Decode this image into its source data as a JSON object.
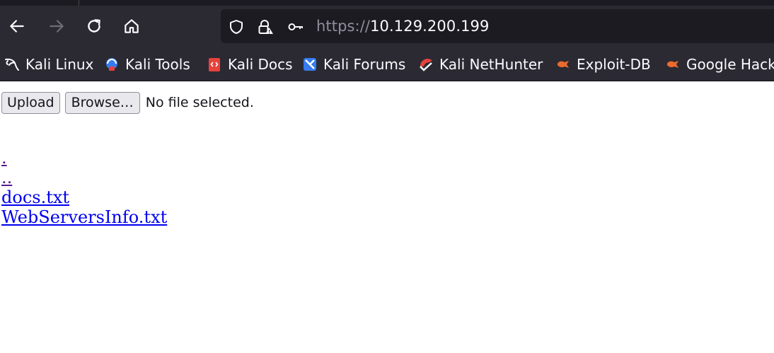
{
  "browser": {
    "url": {
      "scheme": "https://",
      "host": "10.129.200.199"
    },
    "nav_icons": [
      "back-icon",
      "forward-icon",
      "reload-icon",
      "home-icon"
    ],
    "url_icons": [
      "shield-icon",
      "lock-warning-icon",
      "key-icon"
    ],
    "bookmarks": [
      {
        "label": "Kali Linux",
        "icon": "kali-dragon-icon"
      },
      {
        "label": "Kali Tools",
        "icon": "kali-tools-icon"
      },
      {
        "label": "Kali Docs",
        "icon": "kali-docs-icon"
      },
      {
        "label": "Kali Forums",
        "icon": "kali-forums-icon"
      },
      {
        "label": "Kali NetHunter",
        "icon": "kali-nethunter-icon"
      },
      {
        "label": "Exploit-DB",
        "icon": "exploit-db-icon"
      },
      {
        "label": "Google Hack",
        "icon": "google-hacking-icon"
      }
    ],
    "colors": {
      "toolbar": "#2b2a33",
      "urlbar": "#1c1b22",
      "link": "#0000ee",
      "visited_link": "#551a8b"
    }
  },
  "page": {
    "upload_button": "Upload",
    "browse_button": "Browse…",
    "file_status": "No file selected.",
    "listing": [
      {
        "name": ".",
        "visited": true
      },
      {
        "name": "..",
        "visited": true
      },
      {
        "name": "docs.txt",
        "visited": false
      },
      {
        "name": "WebServersInfo.txt",
        "visited": false
      }
    ]
  }
}
